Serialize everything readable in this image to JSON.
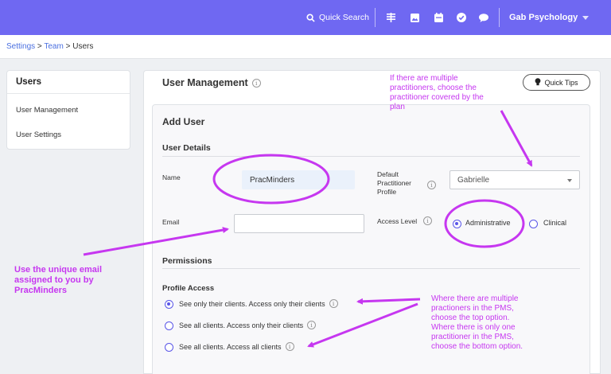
{
  "topbar": {
    "search_label": "Quick Search",
    "practice_name": "Gab Psychology",
    "icons": [
      "search-icon",
      "list-icon",
      "image-icon",
      "calendar-icon",
      "check-icon",
      "chat-icon"
    ],
    "accent": "#6f68f2"
  },
  "breadcrumb": {
    "settings": "Settings",
    "sep": ">",
    "team": "Team",
    "current": "Users"
  },
  "leftnav": {
    "title": "Users",
    "items": [
      {
        "label": "User Management"
      },
      {
        "label": "User Settings"
      }
    ]
  },
  "main": {
    "title": "User Management",
    "quick_tips": "Quick Tips",
    "add_user": "Add User",
    "user_details": "User Details",
    "name_label": "Name",
    "name_value": "PracMinders",
    "default_practitioner_label": [
      "Default",
      "Practitioner",
      "Profile"
    ],
    "default_practitioner_value": "Gabrielle",
    "email_label": "Email",
    "email_value": "",
    "access_level_label": "Access Level",
    "access_options": [
      {
        "label": "Administrative",
        "selected": true
      },
      {
        "label": "Clinical",
        "selected": false
      }
    ],
    "permissions": "Permissions",
    "profile_access": "Profile Access",
    "profile_options": [
      {
        "label": "See only their clients. Access only their clients",
        "selected": true
      },
      {
        "label": "See all clients. Access only their clients",
        "selected": false
      },
      {
        "label": "See all clients. Access all clients",
        "selected": false
      }
    ]
  },
  "annotations": {
    "top_note": [
      "If there are multiple",
      "practitioners, choose the",
      "practitioner covered by the",
      "plan"
    ],
    "left_note": [
      "Use the unique email",
      "assigned to you by",
      "PracMinders"
    ],
    "right_note": [
      "Where there are multiple",
      "practioners in the PMS,",
      "choose the top option.",
      "Where there is only one",
      "practitioner in the PMS,",
      "choose the bottom option."
    ],
    "color": "#c637f0"
  }
}
